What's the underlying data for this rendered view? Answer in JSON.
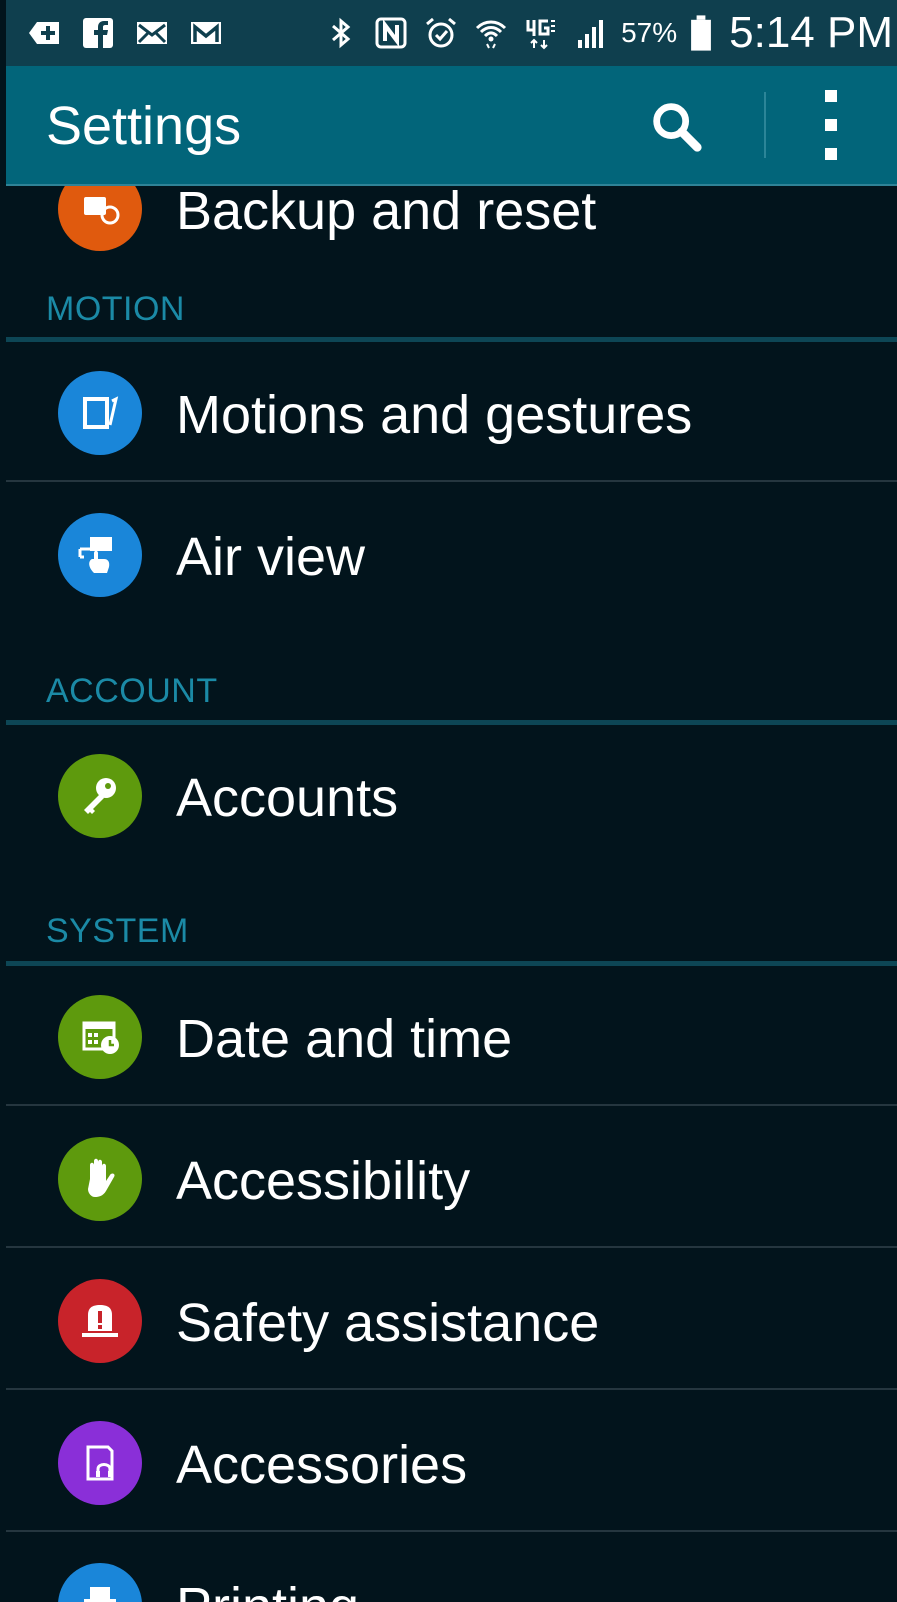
{
  "status_bar": {
    "left_icons": [
      "add-icon",
      "facebook-icon",
      "email-icon",
      "gmail-icon"
    ],
    "right_icons": [
      "bluetooth-icon",
      "nfc-icon",
      "alarm-icon",
      "wifi-icon",
      "lte-icon",
      "signal-icon"
    ],
    "battery_percent": "57%",
    "time": "5:14 PM"
  },
  "action_bar": {
    "title": "Settings",
    "search_icon": "search-icon",
    "overflow_icon": "more-vert-icon"
  },
  "sections": {
    "partial_top": {
      "label": "Backup and reset",
      "icon": "backup-icon",
      "color": "#e05a0e"
    },
    "motion": {
      "header": "MOTION",
      "items": [
        {
          "label": "Motions and gestures",
          "icon": "motion-gesture-icon",
          "color": "#1a86d9"
        },
        {
          "label": "Air view",
          "icon": "air-view-icon",
          "color": "#1a86d9"
        }
      ]
    },
    "account": {
      "header": "ACCOUNT",
      "items": [
        {
          "label": "Accounts",
          "icon": "key-icon",
          "color": "#5e9a0d"
        }
      ]
    },
    "system": {
      "header": "SYSTEM",
      "items": [
        {
          "label": "Date and time",
          "icon": "calendar-clock-icon",
          "color": "#5e9a0d"
        },
        {
          "label": "Accessibility",
          "icon": "hand-icon",
          "color": "#5e9a0d"
        },
        {
          "label": "Safety assistance",
          "icon": "alert-icon",
          "color": "#c8232a"
        },
        {
          "label": "Accessories",
          "icon": "accessories-icon",
          "color": "#8a2fd8"
        },
        {
          "label": "Printing",
          "icon": "printer-icon",
          "color": "#1a86d9"
        }
      ]
    }
  },
  "colors": {
    "status_bar": "#0f3f4e",
    "action_bar": "#02657a",
    "background": "#02141c",
    "section_header": "#1b8aa6"
  }
}
